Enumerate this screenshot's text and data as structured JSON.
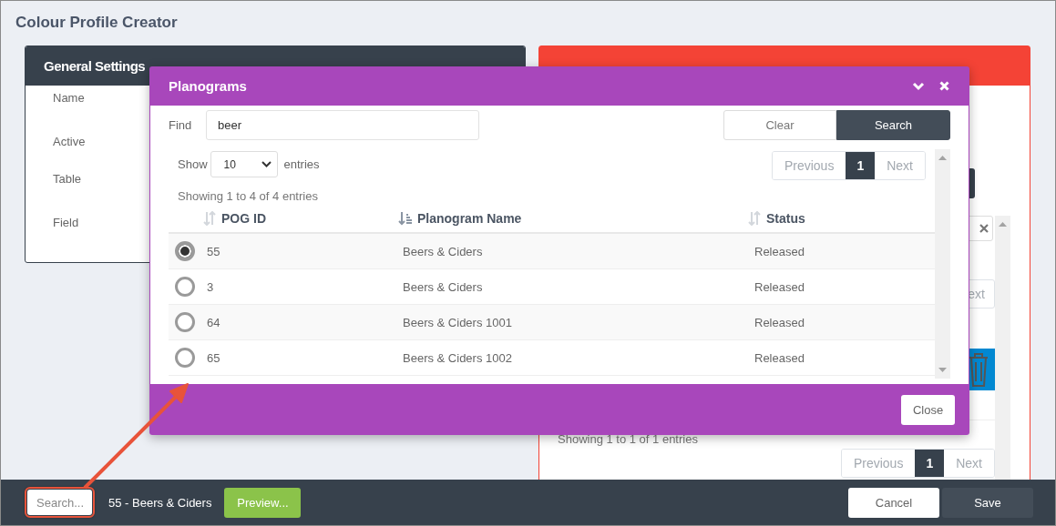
{
  "page": {
    "title": "Colour Profile Creator"
  },
  "general_settings": {
    "title": "General Settings",
    "fields": [
      "Name",
      "Active",
      "Table",
      "Field"
    ]
  },
  "mappings": {
    "next_partial": "ext",
    "summary": "Showing 1 to 1 of 1 entries",
    "pagination": {
      "previous": {
        "label": "Previous",
        "disabled": true
      },
      "pages": [
        {
          "label": "1",
          "selected": true
        }
      ],
      "next": {
        "label": "Next",
        "disabled": true
      }
    }
  },
  "dialog": {
    "title": "Planograms",
    "find_label": "Find",
    "find_value": "beer",
    "buttons": [
      {
        "label": "Clear",
        "kind": "secondary"
      },
      {
        "label": "Search",
        "kind": "primary"
      }
    ],
    "show_label": "Show",
    "page_size": "10",
    "entries_label": "entries",
    "pagination": {
      "previous": {
        "label": "Previous",
        "disabled": true
      },
      "pages": [
        {
          "label": "1",
          "selected": true
        }
      ],
      "next": {
        "label": "Next",
        "disabled": true
      }
    },
    "summary": "Showing 1 to 4 of 4 entries",
    "columns": [
      {
        "label": "POG ID",
        "sorted": false
      },
      {
        "label": "Planogram Name",
        "sorted": true
      },
      {
        "label": "Status",
        "sorted": false
      }
    ],
    "rows": [
      {
        "selected": true,
        "pog_id": "55",
        "name": "Beers & Ciders",
        "status": "Released"
      },
      {
        "selected": false,
        "pog_id": "3",
        "name": "Beers & Ciders",
        "status": "Released"
      },
      {
        "selected": false,
        "pog_id": "64",
        "name": "Beers & Ciders 1001",
        "status": "Released"
      },
      {
        "selected": false,
        "pog_id": "65",
        "name": "Beers & Ciders 1002",
        "status": "Released"
      }
    ],
    "close_button": "Close"
  },
  "footer": {
    "search_placeholder": "Search...",
    "selection": "55 - Beers & Ciders",
    "preview_button": "Preview...",
    "cancel_button": "Cancel",
    "save_button": "Save"
  }
}
